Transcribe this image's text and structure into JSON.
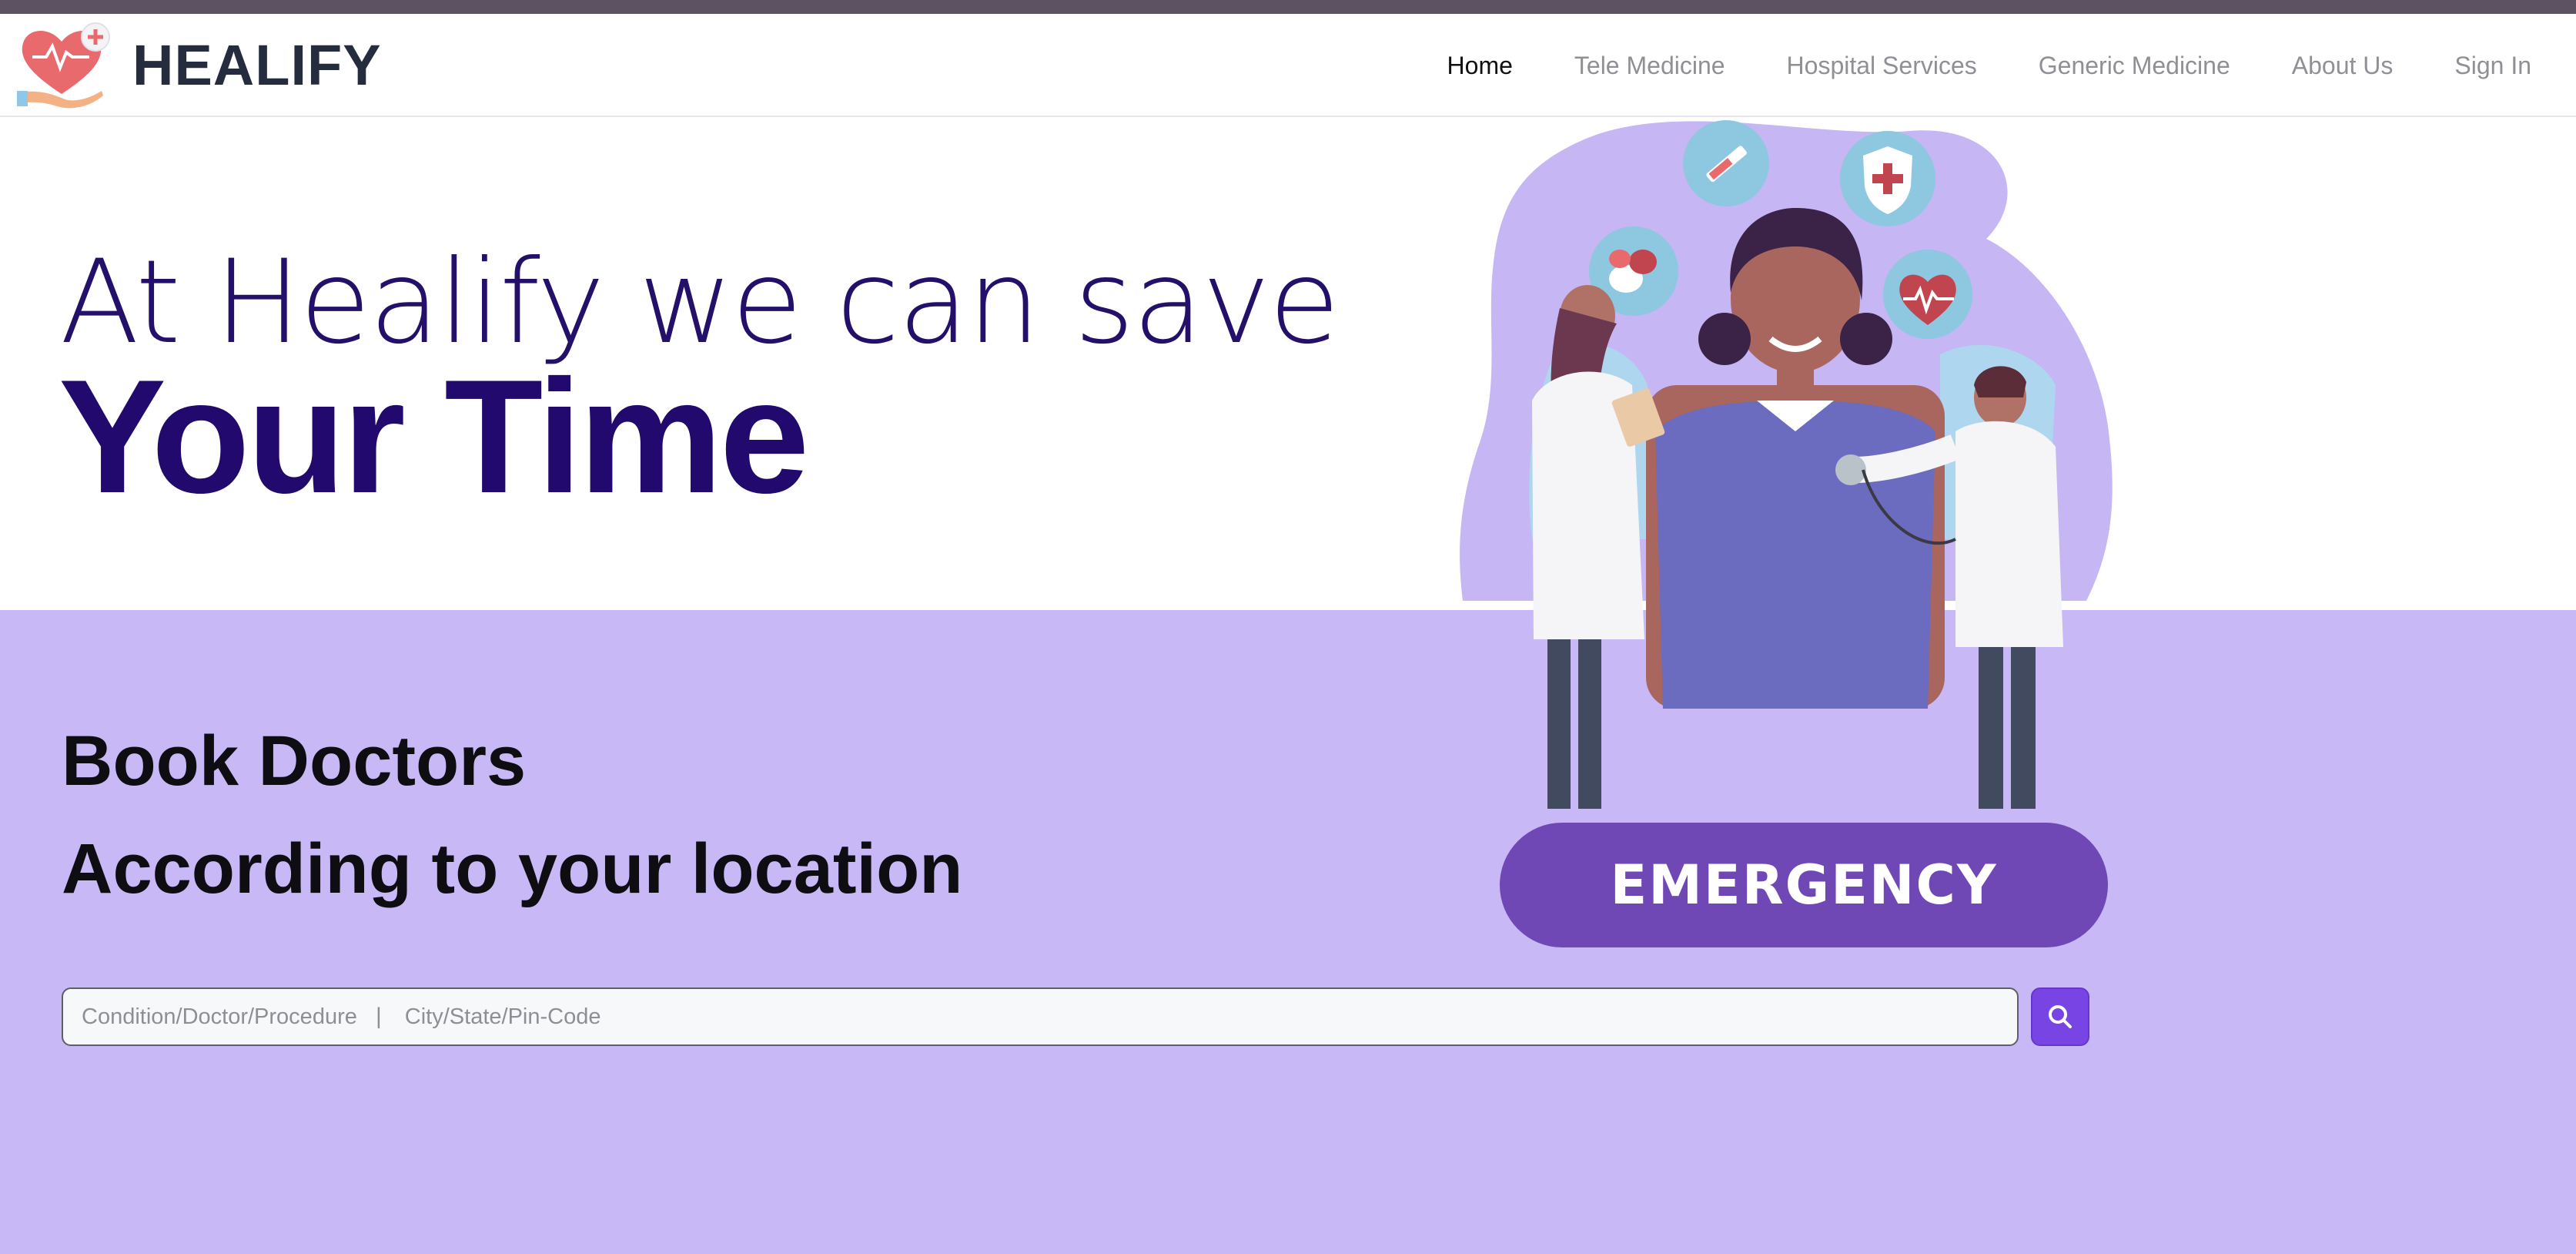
{
  "brand": {
    "name": "HEALIFY",
    "logo_icon": "heart-in-hand-icon"
  },
  "nav": {
    "items": [
      {
        "label": "Home",
        "active": true
      },
      {
        "label": "Tele Medicine",
        "active": false
      },
      {
        "label": "Hospital Services",
        "active": false
      },
      {
        "label": "Generic Medicine",
        "active": false
      },
      {
        "label": "About Us",
        "active": false
      },
      {
        "label": "Sign In",
        "active": false
      }
    ]
  },
  "hero": {
    "headline_light": "At Healify we can save",
    "headline_bold": "Your Time"
  },
  "booking": {
    "title": "Book Doctors",
    "subtitle": "According to your location"
  },
  "search": {
    "condition_placeholder": "Condition/Doctor/Procedure",
    "separator": "|",
    "location_placeholder": "City/State/Pin-Code",
    "button_icon": "search-icon"
  },
  "emergency": {
    "label": "EMERGENCY"
  },
  "illustration": {
    "icons": [
      "syringe-icon",
      "medical-shield-icon",
      "pills-icon",
      "heartbeat-icon"
    ]
  },
  "colors": {
    "band": "#c8b9f6",
    "headline": "#21096e",
    "accent": "#7844e3",
    "emergency": "#6f48b6",
    "nav_active": "#111111",
    "nav_inactive": "#8f8f96"
  }
}
